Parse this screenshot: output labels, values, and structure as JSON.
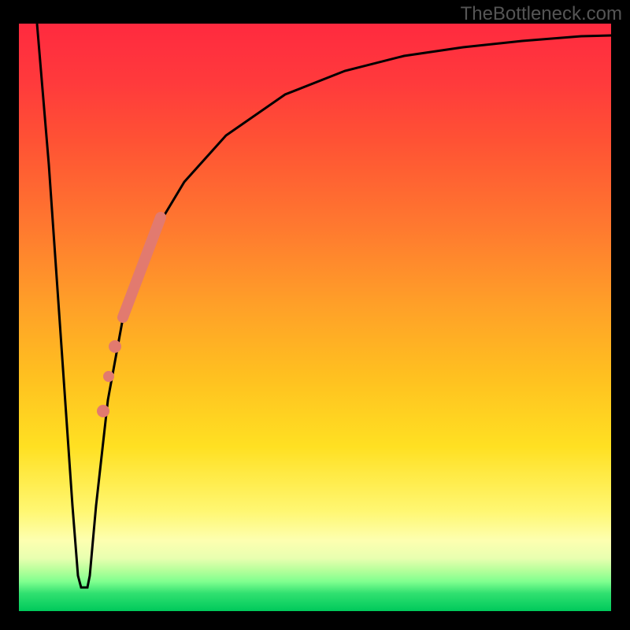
{
  "watermark": "TheBottleneck.com",
  "chart_data": {
    "type": "line",
    "title": "",
    "xlabel": "",
    "ylabel": "",
    "xlim": [
      0,
      100
    ],
    "ylim": [
      0,
      100
    ],
    "grid": false,
    "legend": false,
    "series": [
      {
        "name": "bottleneck-curve",
        "color": "#000000",
        "x": [
          3,
          5,
          7,
          9,
          10,
          11,
          12,
          13,
          15,
          18,
          22,
          28,
          35,
          45,
          55,
          65,
          75,
          85,
          95,
          100
        ],
        "y": [
          100,
          76,
          47,
          18,
          6,
          4,
          6,
          18,
          36,
          52,
          63,
          73,
          81,
          88,
          92,
          94.5,
          96,
          97,
          97.8,
          98
        ]
      }
    ],
    "markers": [
      {
        "name": "highlight-segment",
        "shape": "line",
        "color": "#e27a6f",
        "width": 12,
        "x": [
          17.5,
          24
        ],
        "y": [
          50,
          67
        ]
      },
      {
        "name": "highlight-dot-1",
        "shape": "circle",
        "color": "#e27a6f",
        "r": 7,
        "x": 16.2,
        "y": 45
      },
      {
        "name": "highlight-dot-2",
        "shape": "circle",
        "color": "#e27a6f",
        "r": 6,
        "x": 15.2,
        "y": 40
      },
      {
        "name": "highlight-dot-3",
        "shape": "circle",
        "color": "#e27a6f",
        "r": 7,
        "x": 14.2,
        "y": 34
      }
    ],
    "gradient_background": {
      "top_color": "#ff2a3f",
      "mid_color": "#ffd400",
      "bottom_color": "#00c95b"
    }
  }
}
